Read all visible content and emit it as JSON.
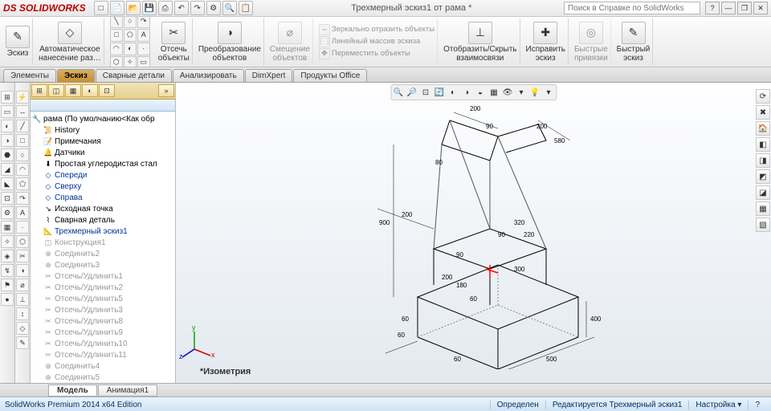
{
  "titlebar": {
    "logo": "DS SOLIDWORKS",
    "title": "Трехмерный эскиз1 от рама *",
    "search_placeholder": "Поиск в Справке по SolidWorks",
    "buttons": {
      "min": "—",
      "rest": "❐",
      "close": "✕",
      "help": "?"
    }
  },
  "qat": [
    "□",
    "▼",
    "📄",
    "📂",
    "💾",
    "⎙",
    "↶",
    "↷",
    "⚙",
    "🔍",
    "📋"
  ],
  "ribbon": {
    "sketch": {
      "label": "Эскиз",
      "icon": "✎"
    },
    "auto": {
      "label": "Автоматическое\nнанесение раз…",
      "icon": "◇"
    },
    "trim": {
      "label": "Отсечь\nобъекты",
      "icon": "✂"
    },
    "convert": {
      "label": "Преобразование\nобъектов",
      "icon": "◑"
    },
    "offset": {
      "label": "Смещение\nобъектов",
      "icon": "⌀"
    },
    "mirror": "Зеркально отразить объекты",
    "pattern": "Линейный массив эскиза",
    "move": "Переместить объекты",
    "showhide": {
      "label": "Отобразить/Скрыть\nвзаимосвязи",
      "icon": "⊥"
    },
    "repair": {
      "label": "Исправить\nэскиз",
      "icon": "✚"
    },
    "snaps": {
      "label": "Быстрые\nпривязки",
      "icon": "◎"
    },
    "quick": {
      "label": "Быстрый\nэскиз",
      "icon": "✎"
    }
  },
  "tools": [
    "╲",
    "○",
    "↷",
    "□",
    "⬠",
    "A",
    "◠",
    "◐",
    "·",
    "⬡",
    "✧",
    "▭"
  ],
  "tabs": [
    "Элементы",
    "Эскиз",
    "Сварные детали",
    "Анализировать",
    "DimXpert",
    "Продукты Office"
  ],
  "tree": {
    "root": "рама  (По умолчанию<Как обр",
    "items": [
      {
        "icon": "📜",
        "label": "History",
        "cls": ""
      },
      {
        "icon": "📝",
        "label": "Примечания",
        "cls": ""
      },
      {
        "icon": "🔔",
        "label": "Датчики",
        "cls": ""
      },
      {
        "icon": "⬇",
        "label": "Простая углеродистая стал",
        "cls": ""
      },
      {
        "icon": "◇",
        "label": "Спереди",
        "cls": "blue"
      },
      {
        "icon": "◇",
        "label": "Сверху",
        "cls": "blue"
      },
      {
        "icon": "◇",
        "label": "Справа",
        "cls": "blue"
      },
      {
        "icon": "↘",
        "label": "Исходная точка",
        "cls": ""
      },
      {
        "icon": "⌇",
        "label": "Сварная деталь",
        "cls": ""
      },
      {
        "icon": "📐",
        "label": "Трехмерный эскиз1",
        "cls": "blue"
      },
      {
        "icon": "◫",
        "label": "Конструкция1",
        "cls": "gray"
      },
      {
        "icon": "⊕",
        "label": "Соединить2",
        "cls": "gray"
      },
      {
        "icon": "⊕",
        "label": "Соединить3",
        "cls": "gray"
      },
      {
        "icon": "✂",
        "label": "Отсечь/Удлинить1",
        "cls": "gray"
      },
      {
        "icon": "✂",
        "label": "Отсечь/Удлинить2",
        "cls": "gray"
      },
      {
        "icon": "✂",
        "label": "Отсечь/Удлинить5",
        "cls": "gray"
      },
      {
        "icon": "✂",
        "label": "Отсечь/Удлинить3",
        "cls": "gray"
      },
      {
        "icon": "✂",
        "label": "Отсечь/Удлинить8",
        "cls": "gray"
      },
      {
        "icon": "✂",
        "label": "Отсечь/Удлинить9",
        "cls": "gray"
      },
      {
        "icon": "✂",
        "label": "Отсечь/Удлинить10",
        "cls": "gray"
      },
      {
        "icon": "✂",
        "label": "Отсечь/Удлинить11",
        "cls": "gray"
      },
      {
        "icon": "⊕",
        "label": "Соединить4",
        "cls": "gray"
      },
      {
        "icon": "⊕",
        "label": "Соединить5",
        "cls": "gray"
      }
    ]
  },
  "viewtb": [
    "🔍",
    "🔎",
    "⊡",
    "🔄",
    "◐",
    "◑",
    "◒",
    "▦",
    "👁",
    "▾",
    "💡",
    "▾"
  ],
  "righttb": [
    "⟳",
    "✖",
    "🏠",
    "◧",
    "◨",
    "◩",
    "◪",
    "▦",
    "▧"
  ],
  "lefttb": [
    "⚡",
    "↔",
    "╱",
    "□",
    "○",
    "◠",
    "⬠",
    "↷",
    "A",
    "·",
    "⬡",
    "✂",
    "◑",
    "⌀",
    "⊥",
    "↕",
    "◇",
    "✎"
  ],
  "lefttb2": [
    "⊞",
    "▭",
    "◐",
    "◑",
    "⬣",
    "◢",
    "◣",
    "⊡",
    "⚙",
    "▦",
    "✧",
    "◈",
    "↯",
    "⚑",
    "●"
  ],
  "dims": {
    "d200a": "200",
    "d90a": "90",
    "d200b": "200",
    "d580": "580",
    "d80": "80",
    "d200c": "200",
    "d900": "900",
    "d320": "320",
    "d90b": "90",
    "d220": "220",
    "d90c": "90",
    "d200d": "200",
    "d180": "180",
    "d300": "300",
    "d60a": "60",
    "d60b": "60",
    "d60c": "60",
    "d400": "400",
    "d500": "500",
    "d60d": "60"
  },
  "triad": {
    "x": "x",
    "y": "y",
    "z": "z"
  },
  "viewlabel": "*Изометрия",
  "bottab": {
    "model": "Модель",
    "anim": "Анимация1"
  },
  "status": {
    "edition": "SolidWorks Premium 2014 x64 Edition",
    "state": "Определен",
    "editing": "Редактируется Трехмерный эскиз1",
    "custom": "Настройка ▾"
  }
}
